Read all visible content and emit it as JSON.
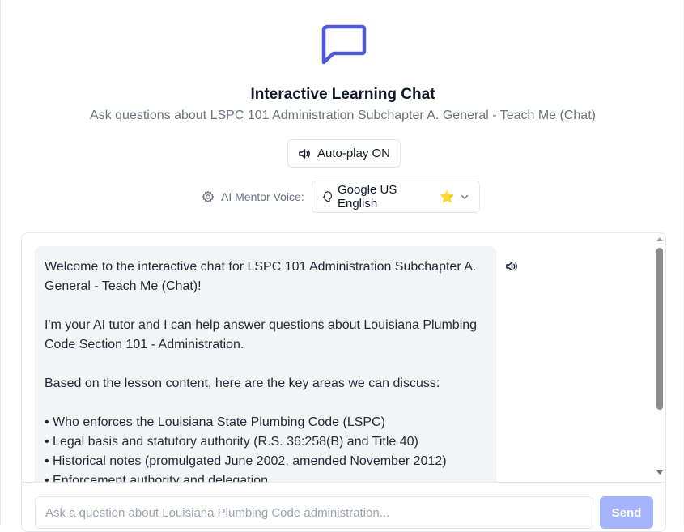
{
  "header": {
    "title": "Interactive Learning Chat",
    "subtitle": "Ask questions about LSPC 101 Administration Subchapter A. General - Teach Me (Chat)",
    "logo_icon": "message-square-icon",
    "accent_color": "#4f5bd5"
  },
  "autoplay": {
    "label": "Auto-play ON",
    "icon": "volume-icon"
  },
  "voice": {
    "label": "AI Mentor Voice:",
    "label_icon": "gear-icon",
    "selected": "Google US English",
    "selected_icon": "voice-icon",
    "badge": "⭐"
  },
  "chat": {
    "message": {
      "intro": "Welcome to the interactive chat for LSPC 101 Administration  Subchapter A. General - Teach Me (Chat)!",
      "tutor": "I'm your AI tutor and I can help answer questions about Louisiana Plumbing Code Section 101 - Administration.",
      "lead": "Based on the lesson content, here are the key areas we can discuss:",
      "bullets": [
        "Who enforces the Louisiana State Plumbing Code (LSPC)",
        "Legal basis and statutory authority (R.S. 36:258(B) and Title 40)",
        "Historical notes (promulgated June 2002, amended November 2012)",
        "Enforcement authority and delegation"
      ]
    },
    "input_placeholder": "Ask a question about Louisiana Plumbing Code administration...",
    "send_label": "Send",
    "send_color": "#a5b4fc"
  }
}
